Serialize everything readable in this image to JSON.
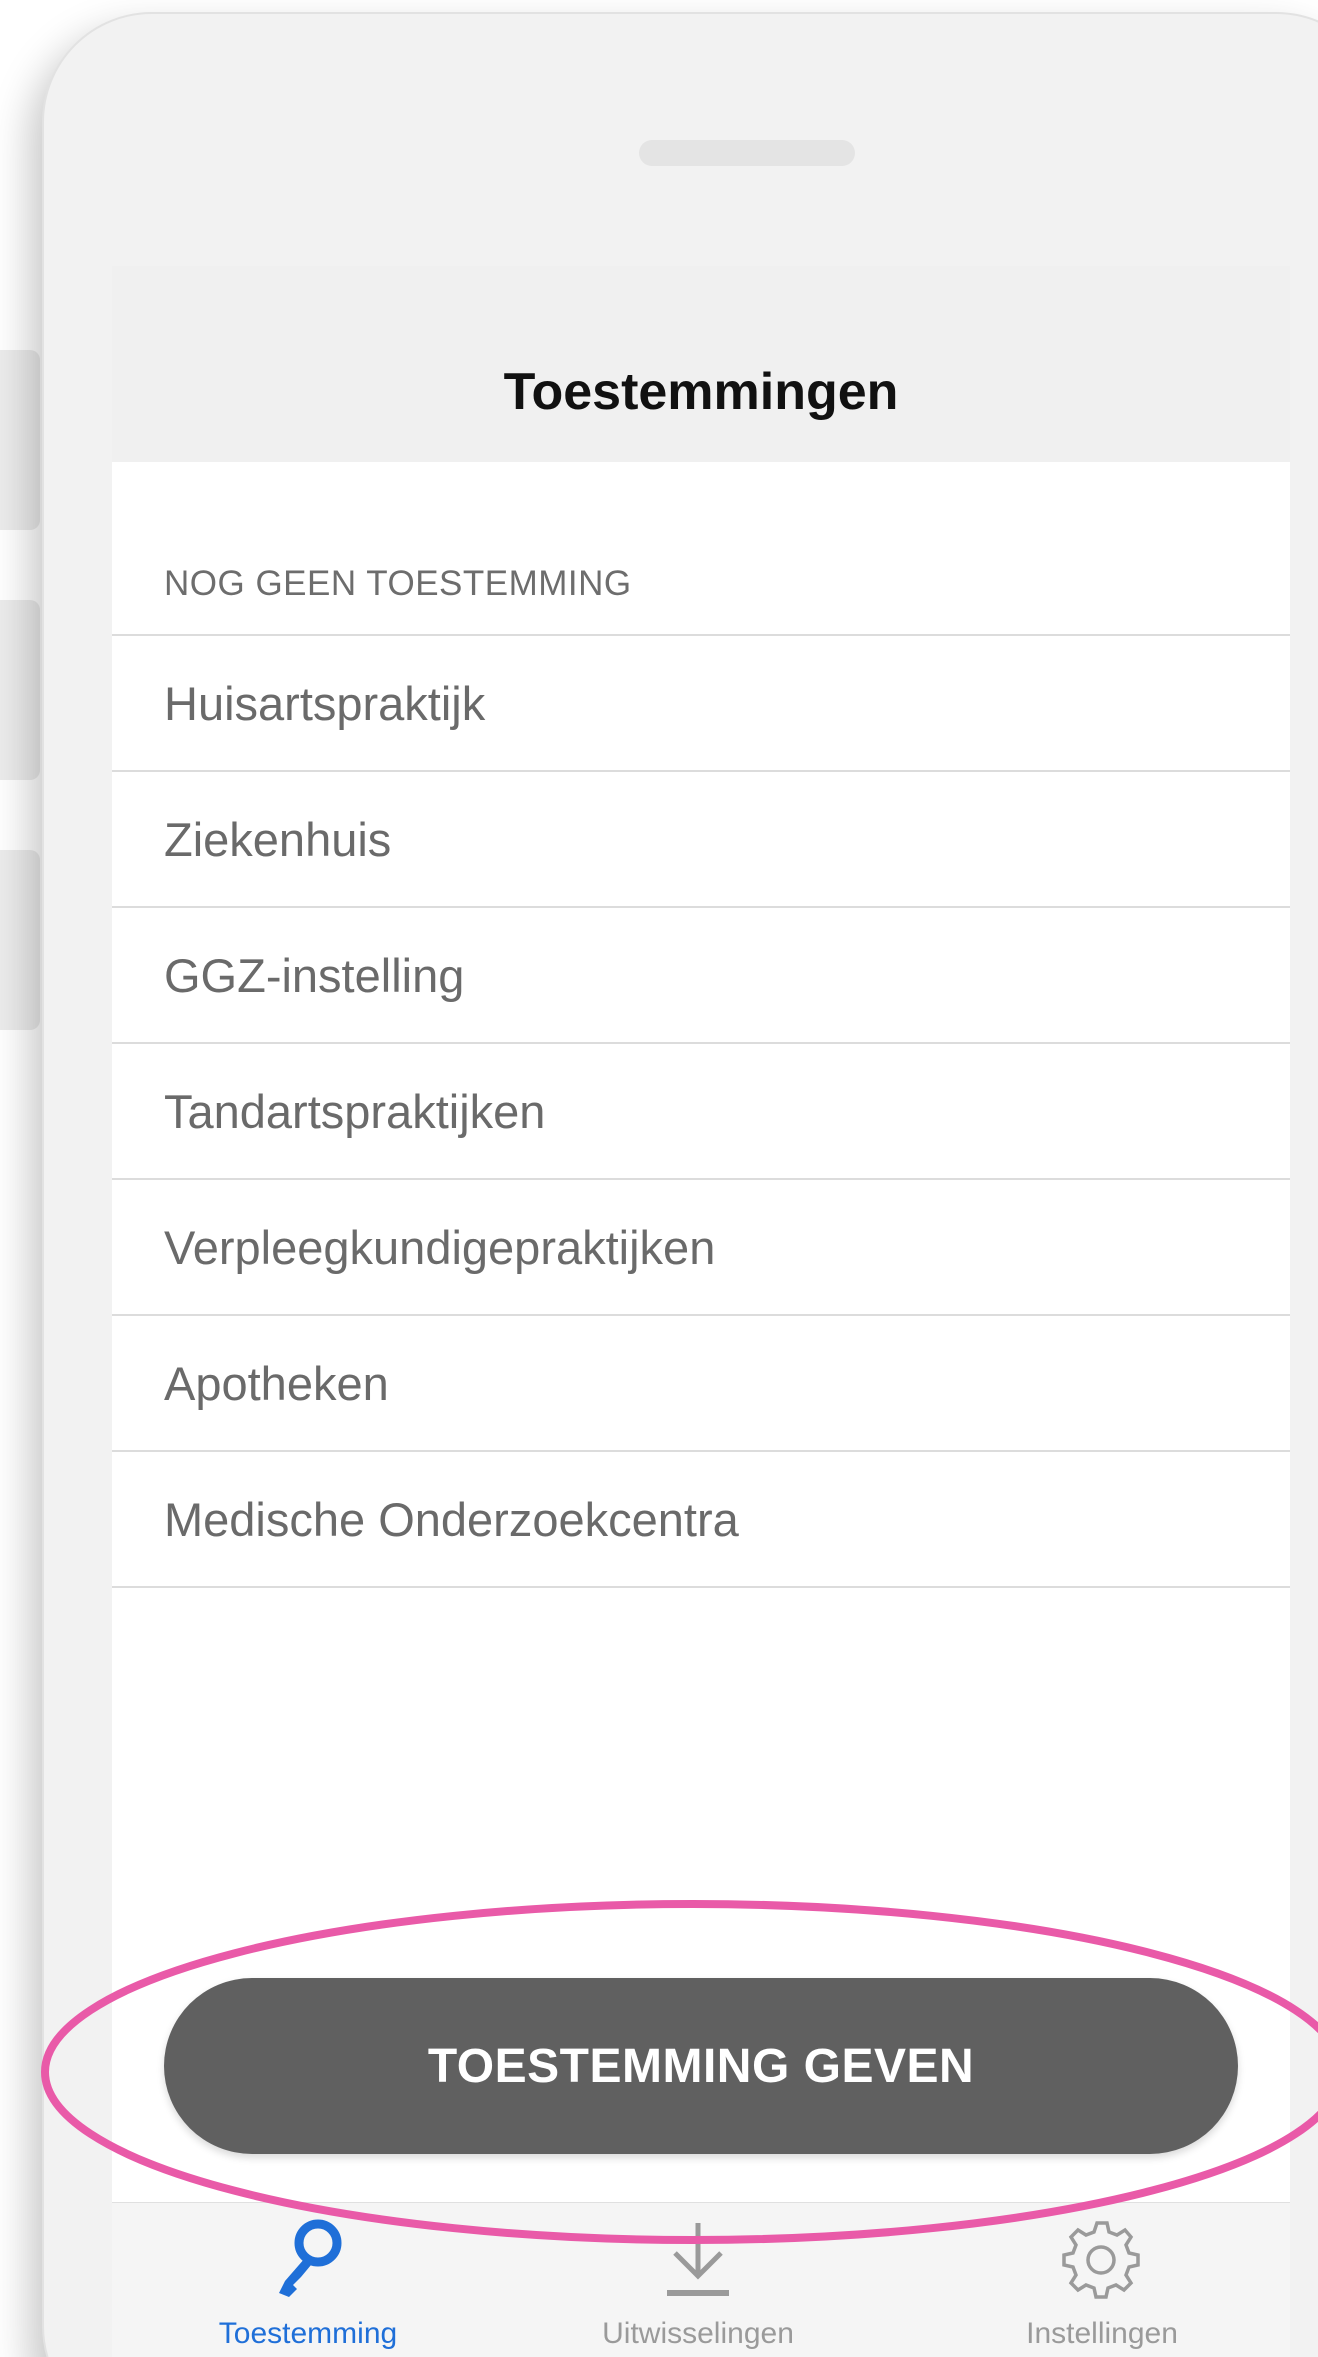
{
  "navbar": {
    "title": "Toestemmingen"
  },
  "section": {
    "header": "NOG GEEN TOESTEMMING"
  },
  "list": {
    "items": [
      {
        "label": "Huisartspraktijk"
      },
      {
        "label": "Ziekenhuis"
      },
      {
        "label": "GGZ-instelling"
      },
      {
        "label": "Tandartspraktijken"
      },
      {
        "label": "Verpleegkundigepraktijken"
      },
      {
        "label": "Apotheken"
      },
      {
        "label": "Medische Onderzoekcentra"
      }
    ]
  },
  "primary_button": {
    "label": "TOESTEMMING GEVEN"
  },
  "tabbar": {
    "tabs": [
      {
        "label": "Toestemming",
        "icon": "key-icon",
        "active": true
      },
      {
        "label": "Uitwisselingen",
        "icon": "download-icon",
        "active": false
      },
      {
        "label": "Instellingen",
        "icon": "gear-icon",
        "active": false
      }
    ]
  },
  "colors": {
    "accent": "#1f6fd8",
    "button_bg": "#606060",
    "highlight": "#e95aa8",
    "inactive_tab": "#9a9a9a"
  }
}
